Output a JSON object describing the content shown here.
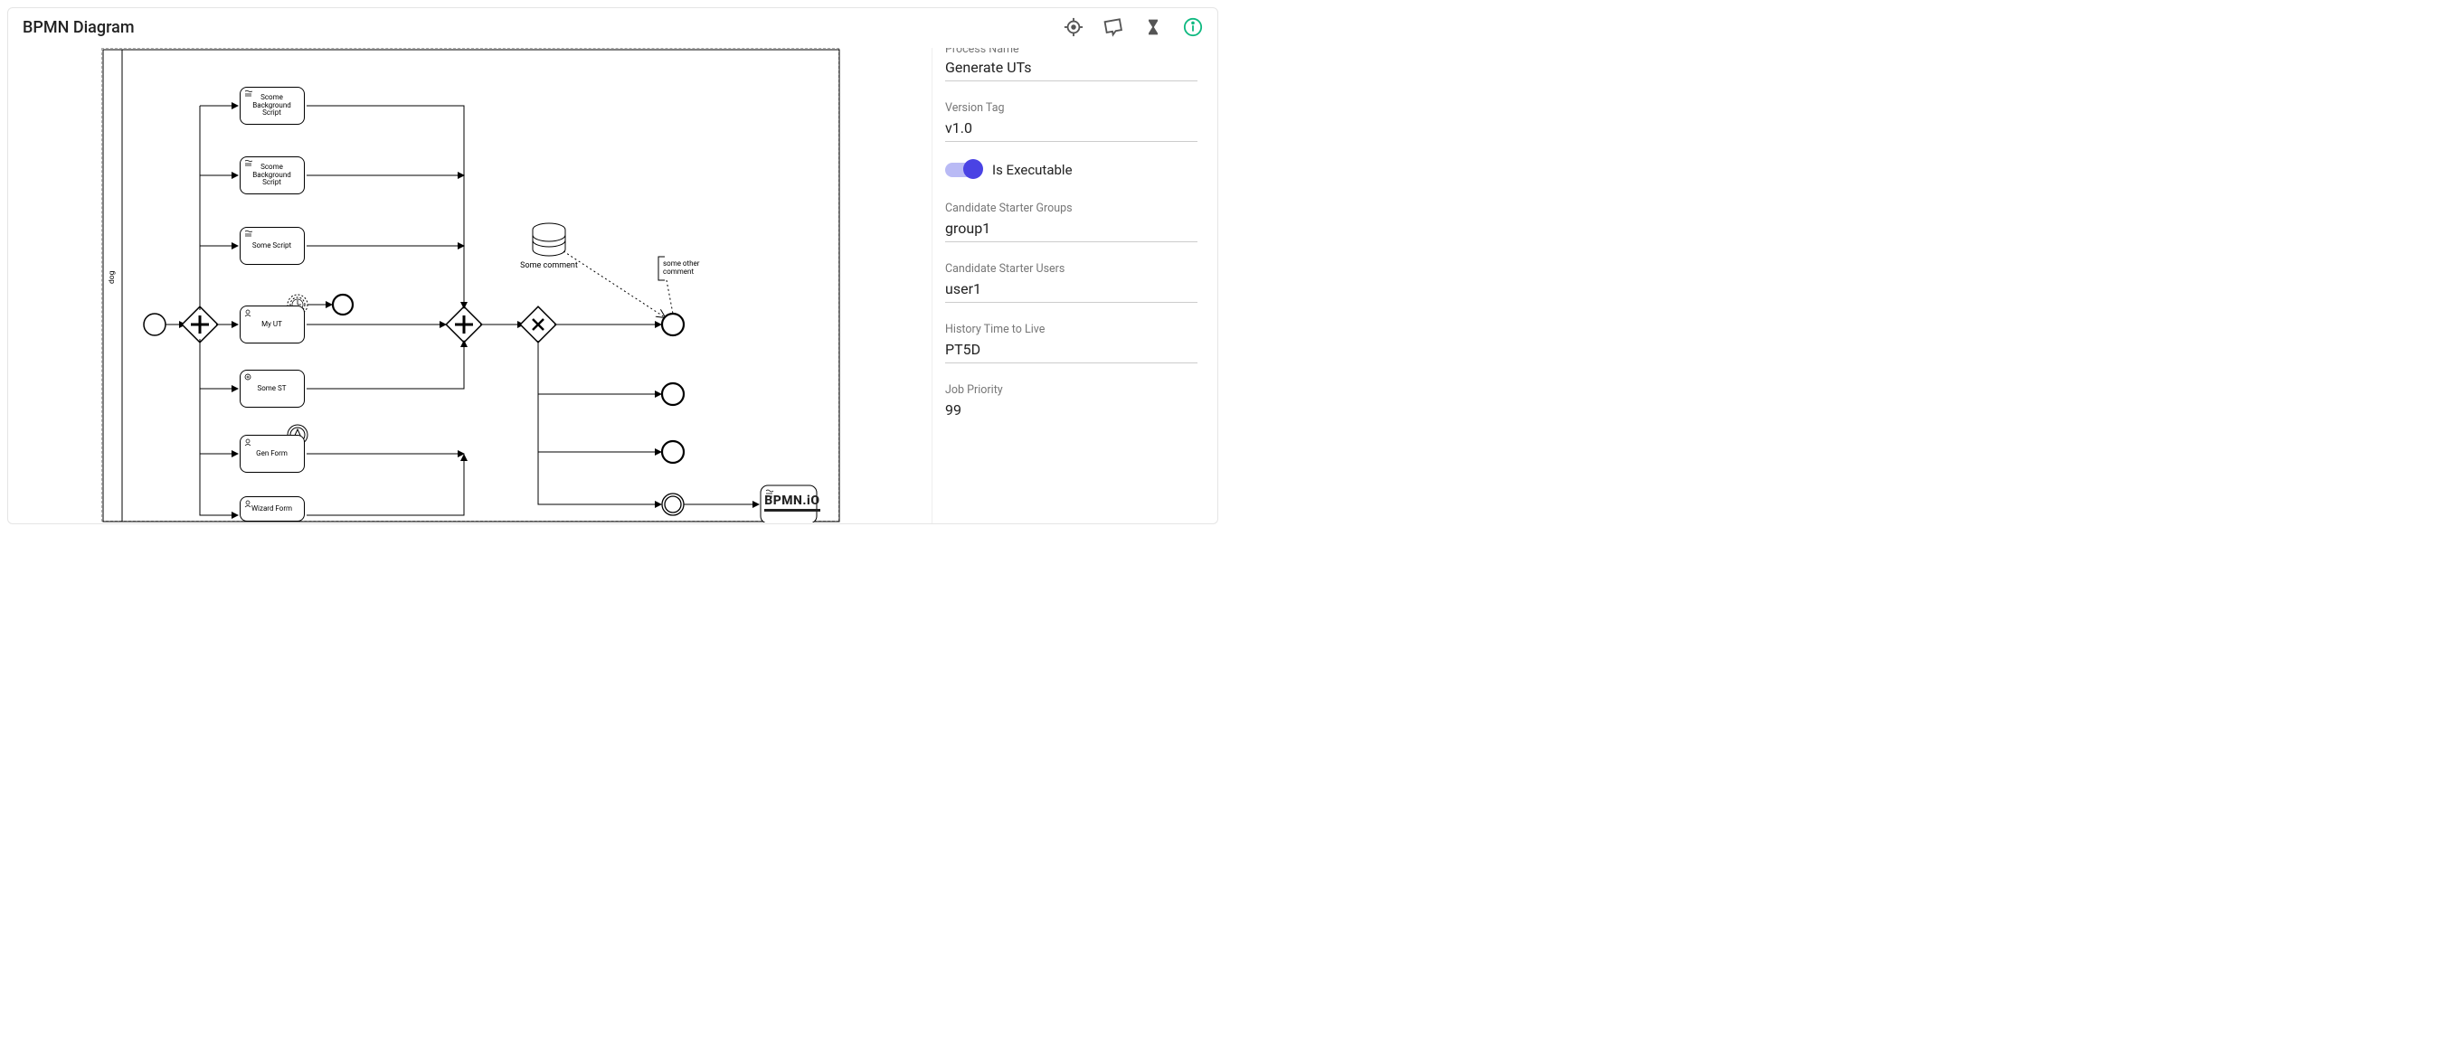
{
  "header": {
    "title": "BPMN Diagram",
    "logo": "BPMN.iO"
  },
  "toolbar": {
    "icons": [
      "target-icon",
      "send-icon",
      "hourglass-icon",
      "info-icon"
    ]
  },
  "diagram": {
    "lane_label": "dog",
    "tasks": {
      "bg1": "Scome Background Script",
      "bg2": "Scome Background Script",
      "some_script": "Some Script",
      "my_ut": "My UT",
      "some_st": "Some ST",
      "gen_form": "Gen Form",
      "wizard_form": "Wizard Form"
    },
    "annotations": {
      "data_store_comment": "Some comment",
      "other_comment": "some other comment"
    }
  },
  "panel": {
    "process_name": {
      "label": "Process Name",
      "value": "Generate UTs"
    },
    "version_tag": {
      "label": "Version Tag",
      "value": "v1.0"
    },
    "is_executable": {
      "label": "Is Executable",
      "value": true
    },
    "candidate_groups": {
      "label": "Candidate Starter Groups",
      "value": "group1"
    },
    "candidate_users": {
      "label": "Candidate Starter Users",
      "value": "user1"
    },
    "htl": {
      "label": "History Time to Live",
      "value": "PT5D"
    },
    "job_priority": {
      "label": "Job Priority",
      "value": "99"
    }
  }
}
